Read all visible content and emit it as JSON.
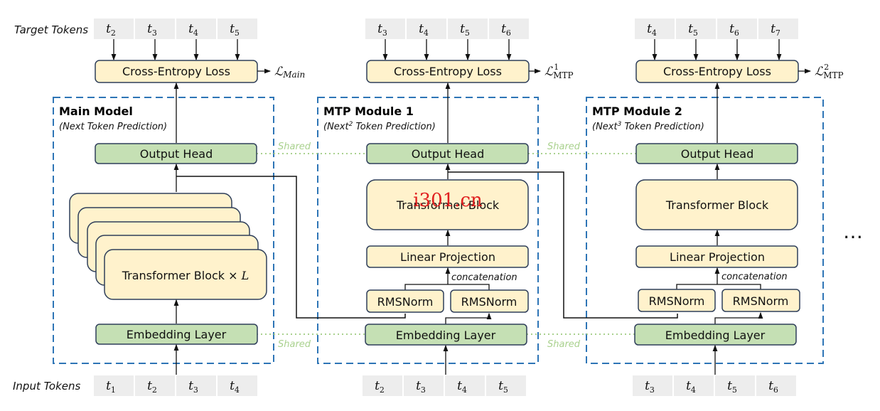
{
  "labels": {
    "target_tokens": "Target Tokens",
    "input_tokens": "Input Tokens",
    "shared": "Shared",
    "concatenation": "concatenation",
    "ellipsis": "…",
    "watermark": "i301.cn"
  },
  "modules": [
    {
      "title": "Main Model",
      "subtitle_pre": "(Next",
      "subtitle_sup": "",
      "subtitle_post": " Token Prediction)",
      "target_tokens": [
        {
          "base": "t",
          "sub": "2"
        },
        {
          "base": "t",
          "sub": "3"
        },
        {
          "base": "t",
          "sub": "4"
        },
        {
          "base": "t",
          "sub": "5"
        }
      ],
      "input_tokens": [
        {
          "base": "t",
          "sub": "1"
        },
        {
          "base": "t",
          "sub": "2"
        },
        {
          "base": "t",
          "sub": "3"
        },
        {
          "base": "t",
          "sub": "4"
        }
      ],
      "loss_block": "Cross-Entropy Loss",
      "loss_symbol": "ℒ",
      "loss_sub": "Main",
      "loss_sup": "",
      "output_head": "Output Head",
      "transformer": "Transformer Block × ",
      "transformer_var": "L",
      "embedding": "Embedding Layer"
    },
    {
      "title": "MTP Module 1",
      "subtitle_pre": "(Next",
      "subtitle_sup": "2",
      "subtitle_post": " Token Prediction)",
      "target_tokens": [
        {
          "base": "t",
          "sub": "3"
        },
        {
          "base": "t",
          "sub": "4"
        },
        {
          "base": "t",
          "sub": "5"
        },
        {
          "base": "t",
          "sub": "6"
        }
      ],
      "input_tokens": [
        {
          "base": "t",
          "sub": "2"
        },
        {
          "base": "t",
          "sub": "3"
        },
        {
          "base": "t",
          "sub": "4"
        },
        {
          "base": "t",
          "sub": "5"
        }
      ],
      "loss_block": "Cross-Entropy Loss",
      "loss_symbol": "ℒ",
      "loss_sub": "MTP",
      "loss_sup": "1",
      "output_head": "Output Head",
      "transformer": "Transformer Block",
      "transformer_var": "",
      "linear_projection": "Linear Projection",
      "rmsnorm_left": "RMSNorm",
      "rmsnorm_right": "RMSNorm",
      "embedding": "Embedding Layer"
    },
    {
      "title": "MTP Module 2",
      "subtitle_pre": "(Next",
      "subtitle_sup": "3",
      "subtitle_post": " Token Prediction)",
      "target_tokens": [
        {
          "base": "t",
          "sub": "4"
        },
        {
          "base": "t",
          "sub": "5"
        },
        {
          "base": "t",
          "sub": "6"
        },
        {
          "base": "t",
          "sub": "7"
        }
      ],
      "input_tokens": [
        {
          "base": "t",
          "sub": "3"
        },
        {
          "base": "t",
          "sub": "4"
        },
        {
          "base": "t",
          "sub": "5"
        },
        {
          "base": "t",
          "sub": "6"
        }
      ],
      "loss_block": "Cross-Entropy Loss",
      "loss_symbol": "ℒ",
      "loss_sub": "MTP",
      "loss_sup": "2",
      "output_head": "Output Head",
      "transformer": "Transformer Block",
      "transformer_var": "",
      "linear_projection": "Linear Projection",
      "rmsnorm_left": "RMSNorm",
      "rmsnorm_right": "RMSNorm",
      "embedding": "Embedding Layer"
    }
  ],
  "colors": {
    "yellow_fill": "#fff2cc",
    "green_fill": "#c5e0b4",
    "block_stroke": "#2f3f5a",
    "dash_blue": "#2e75b6",
    "token_bg": "#ededed",
    "shared_green": "#a9d18e"
  }
}
